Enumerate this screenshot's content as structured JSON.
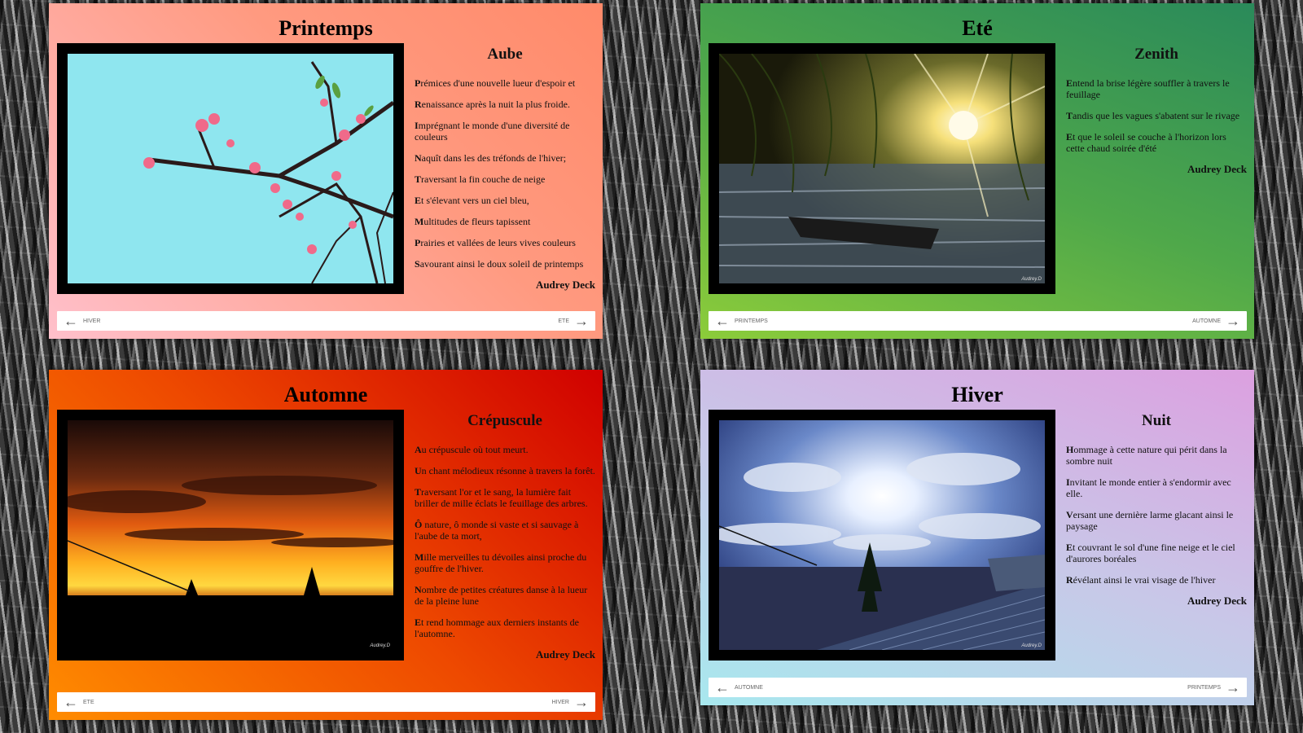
{
  "cards": [
    {
      "title": "Printemps",
      "poem_title": "Aube",
      "lines": [
        {
          "first": "P",
          "rest": "rémices d'une nouvelle lueur d'espoir et"
        },
        {
          "first": "R",
          "rest": "enaissance après la nuit la plus froide."
        },
        {
          "first": "I",
          "rest": "mprégnant le monde d'une diversité de couleurs"
        },
        {
          "first": "N",
          "rest": "aquît dans les des tréfonds de l'hiver;"
        },
        {
          "first": "T",
          "rest": "raversant la fin couche de neige"
        },
        {
          "first": "E",
          "rest": "t s'élevant vers un ciel bleu,"
        },
        {
          "first": "M",
          "rest": "ultitudes de fleurs tapissent"
        },
        {
          "first": "P",
          "rest": "rairies et vallées de leurs vives couleurs"
        },
        {
          "first": "S",
          "rest": "avourant ainsi le doux soleil de printemps"
        }
      ],
      "author": "Audrey Deck",
      "watermark": "",
      "nav_prev": "HIVER",
      "nav_next": "ETE"
    },
    {
      "title": "Eté",
      "poem_title": "Zenith",
      "lines": [
        {
          "first": "E",
          "rest": "ntend la brise légère souffler à travers le feuillage"
        },
        {
          "first": "T",
          "rest": "andis que les vagues s'abatent sur le rivage"
        },
        {
          "first": "E",
          "rest": "t que le soleil se couche à l'horizon lors cette chaud soirée d'été"
        }
      ],
      "author": "Audrey Deck",
      "watermark": "Audrey.D",
      "nav_prev": "PRINTEMPS",
      "nav_next": "AUTOMNE"
    },
    {
      "title": "Automne",
      "poem_title": "Crépuscule",
      "lines": [
        {
          "first": "A",
          "rest": "u crépuscule où tout meurt."
        },
        {
          "first": "U",
          "rest": "n chant mélodieux résonne à travers la forêt."
        },
        {
          "first": "T",
          "rest": "raversant l'or et le sang, la lumière fait briller de mille éclats le feuillage des arbres."
        },
        {
          "first": "Ô",
          "rest": " nature, ô monde si vaste et si sauvage à l'aube de ta mort,"
        },
        {
          "first": "M",
          "rest": "ille merveilles tu dévoiles ainsi proche du gouffre de l'hiver."
        },
        {
          "first": "N",
          "rest": "ombre de petites créatures danse à la lueur de la pleine lune"
        },
        {
          "first": "E",
          "rest": "t rend hommage aux derniers instants de l'automne."
        }
      ],
      "author": "Audrey Deck",
      "watermark": "Audrey.D",
      "nav_prev": "ETE",
      "nav_next": "HIVER"
    },
    {
      "title": "Hiver",
      "poem_title": "Nuit",
      "lines": [
        {
          "first": "H",
          "rest": "ommage à cette nature qui périt dans la sombre nuit"
        },
        {
          "first": "I",
          "rest": "nvitant le monde entier à s'endormir avec elle."
        },
        {
          "first": "V",
          "rest": "ersant une dernière larme glacant ainsi le paysage"
        },
        {
          "first": "E",
          "rest": "t couvrant le sol d'une fine neige et le ciel d'aurores boréales"
        },
        {
          "first": "R",
          "rest": "évélant ainsi le vrai visage de l'hiver"
        }
      ],
      "author": "Audrey Deck",
      "watermark": "Audrey.D",
      "nav_prev": "AUTOMNE",
      "nav_next": "PRINTEMPS"
    }
  ],
  "colors": {
    "spring": [
      "#ffb6c1",
      "#ff8c66"
    ],
    "summer": [
      "#8ac43a",
      "#2e8b57"
    ],
    "autumn": [
      "#ff8a00",
      "#d60000"
    ],
    "winter": [
      "#b0e8ef",
      "#d9a8e0"
    ]
  },
  "icons": {
    "prev": "arrow-left-icon",
    "next": "arrow-right-icon"
  }
}
